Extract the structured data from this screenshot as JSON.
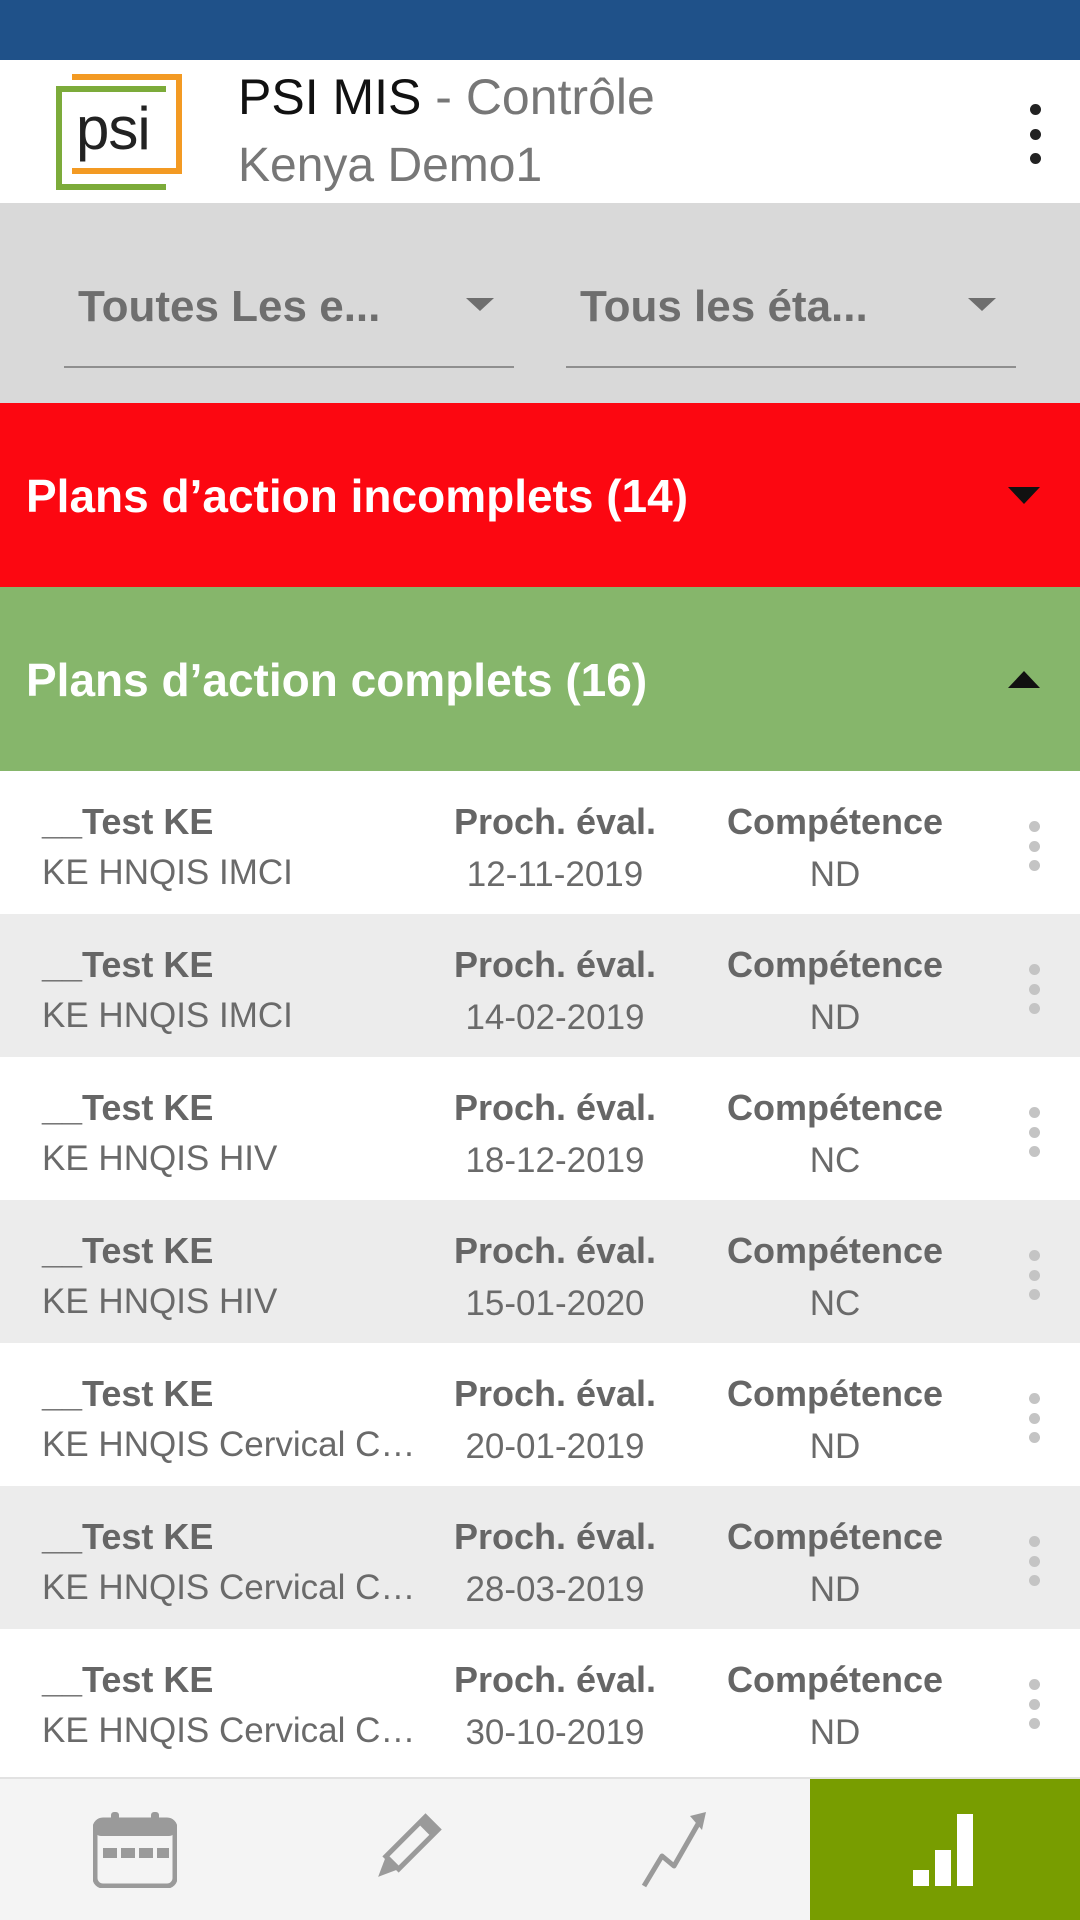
{
  "app": {
    "title": "PSI MIS",
    "separator": " - ",
    "subtitle": "Contrôle",
    "org": "Kenya Demo1",
    "logo_text": "psi"
  },
  "filters": [
    {
      "value": "Toutes Les e..."
    },
    {
      "value": "Tous les éta..."
    }
  ],
  "sections": {
    "incomplete": {
      "label": "Plans d’action incomplets (14)",
      "color": "#fc0711",
      "expanded": false
    },
    "complete": {
      "label": "Plans d’action complets (16)",
      "color": "#86b66b",
      "expanded": true
    }
  },
  "rows": [
    {
      "name": "__Test KE",
      "program": "KE HNQIS IMCI",
      "next_label": "Proch. éval.",
      "next_date": "12-11-2019",
      "comp_label": "Compétence",
      "competence": "ND"
    },
    {
      "name": "__Test KE",
      "program": "KE HNQIS IMCI",
      "next_label": "Proch. éval.",
      "next_date": "14-02-2019",
      "comp_label": "Compétence",
      "competence": "ND"
    },
    {
      "name": "__Test KE",
      "program": "KE HNQIS HIV",
      "next_label": "Proch. éval.",
      "next_date": "18-12-2019",
      "comp_label": "Compétence",
      "competence": "NC"
    },
    {
      "name": "__Test KE",
      "program": "KE HNQIS HIV",
      "next_label": "Proch. éval.",
      "next_date": "15-01-2020",
      "comp_label": "Compétence",
      "competence": "NC"
    },
    {
      "name": "__Test KE",
      "program": "KE HNQIS Cervical Ca...",
      "next_label": "Proch. éval.",
      "next_date": "20-01-2019",
      "comp_label": "Compétence",
      "competence": "ND"
    },
    {
      "name": "__Test KE",
      "program": "KE HNQIS Cervical Ca...",
      "next_label": "Proch. éval.",
      "next_date": "28-03-2019",
      "comp_label": "Compétence",
      "competence": "ND"
    },
    {
      "name": "__Test KE",
      "program": "KE HNQIS Cervical Ca...",
      "next_label": "Proch. éval.",
      "next_date": "30-10-2019",
      "comp_label": "Compétence",
      "competence": "ND"
    }
  ],
  "bottom_nav": [
    {
      "icon": "calendar-icon",
      "active": false
    },
    {
      "icon": "pencil-icon",
      "active": false
    },
    {
      "icon": "trend-icon",
      "active": false
    },
    {
      "icon": "bar-signal-icon",
      "active": true
    }
  ],
  "colors": {
    "status_bar": "#1f5189",
    "active_tab": "#789d00"
  }
}
